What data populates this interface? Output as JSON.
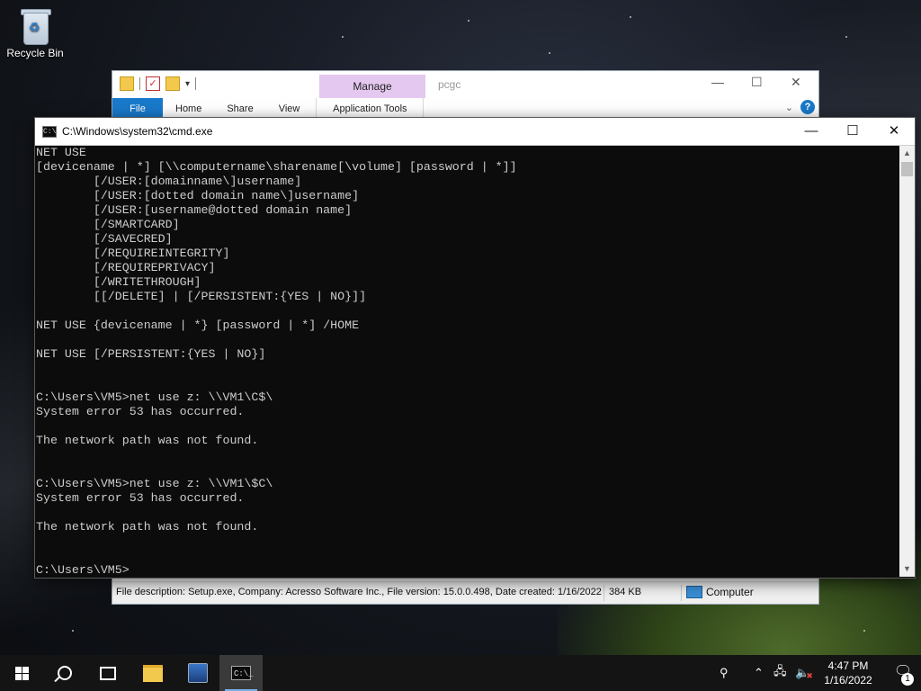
{
  "desktop": {
    "recycle_bin_label": "Recycle Bin"
  },
  "explorer": {
    "title": "pcgc",
    "manage_label": "Manage",
    "tabs": [
      "File",
      "Home",
      "Share",
      "View"
    ],
    "app_tools_label": "Application Tools",
    "help_label": "?",
    "status": {
      "description": "File description: Setup.exe, Company: Acresso Software Inc., File version: 15.0.0.498, Date created: 1/16/2022",
      "size": "384 KB",
      "location": "Computer"
    }
  },
  "cmd": {
    "title": "C:\\Windows\\system32\\cmd.exe",
    "lines": [
      "NET USE",
      "[devicename | *] [\\\\computername\\sharename[\\volume] [password | *]]",
      "        [/USER:[domainname\\]username]",
      "        [/USER:[dotted domain name\\]username]",
      "        [/USER:[username@dotted domain name]",
      "        [/SMARTCARD]",
      "        [/SAVECRED]",
      "        [/REQUIREINTEGRITY]",
      "        [/REQUIREPRIVACY]",
      "        [/WRITETHROUGH]",
      "        [[/DELETE] | [/PERSISTENT:{YES | NO}]]",
      "",
      "NET USE {devicename | *} [password | *] /HOME",
      "",
      "NET USE [/PERSISTENT:{YES | NO}]",
      "",
      "",
      "C:\\Users\\VM5>net use z: \\\\VM1\\C$\\",
      "System error 53 has occurred.",
      "",
      "The network path was not found.",
      "",
      "",
      "C:\\Users\\VM5>net use z: \\\\VM1\\$C\\",
      "System error 53 has occurred.",
      "",
      "The network path was not found.",
      "",
      "",
      "C:\\Users\\VM5>"
    ]
  },
  "taskbar": {
    "clock_time": "4:47 PM",
    "clock_date": "1/16/2022",
    "notification_count": "1",
    "icons": [
      "windows-start-icon",
      "search-icon",
      "task-view-icon",
      "file-explorer-icon",
      "setup-app-icon",
      "cmd-icon"
    ]
  },
  "colors": {
    "console_bg": "#0c0c0c",
    "console_fg": "#cccccc",
    "accent": "#1979ca",
    "manage_tab": "#e4c8f0"
  }
}
